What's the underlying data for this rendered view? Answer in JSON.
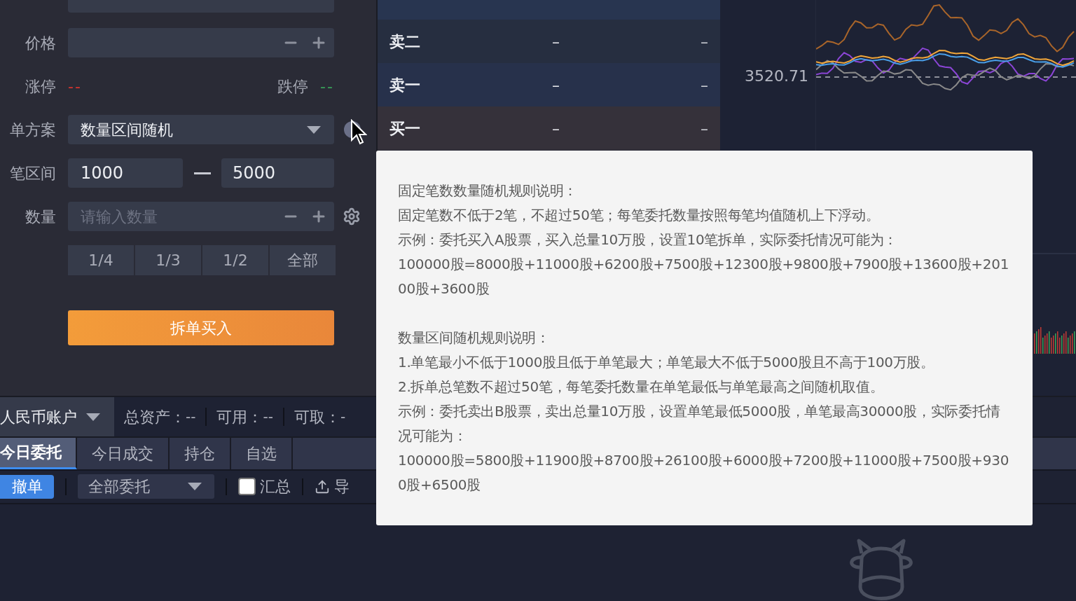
{
  "order_form": {
    "price": {
      "label": "价格"
    },
    "limits": [
      {
        "label": "涨停",
        "value": "--",
        "kind": "up"
      },
      {
        "label": "跌停",
        "value": "--",
        "kind": "down"
      }
    ],
    "split_plan": {
      "label": "单方案",
      "value": "数量区间随机"
    },
    "range": {
      "label": "笔区间",
      "min": "1000",
      "max": "5000"
    },
    "quantity": {
      "label": "数量",
      "placeholder": "请输入数量"
    },
    "fractions": [
      "1/4",
      "1/3",
      "1/2",
      "全部"
    ],
    "submit": "拆单买入"
  },
  "order_book": {
    "rows": [
      {
        "label": "卖二",
        "price": "–",
        "volume": "–",
        "kind": "sell"
      },
      {
        "label": "卖一",
        "price": "–",
        "volume": "–",
        "kind": "sell"
      },
      {
        "label": "买一",
        "price": "–",
        "volume": "–",
        "kind": "buy"
      }
    ]
  },
  "chart": {
    "price_label": "3520.71"
  },
  "account_bar": {
    "account": "人民币账户",
    "stats": [
      {
        "label": "总资产：",
        "value": "--"
      },
      {
        "label": "可用：",
        "value": "--"
      },
      {
        "label": "可取：",
        "value": "-"
      }
    ]
  },
  "tabs": [
    {
      "label": "今日委托",
      "selected": true
    },
    {
      "label": "今日成交",
      "selected": false
    },
    {
      "label": "持仓",
      "selected": false
    },
    {
      "label": "自选",
      "selected": false
    }
  ],
  "toolbar": {
    "cancel": "撤单",
    "filter": "全部委托",
    "summary": {
      "label": "汇总",
      "checked": false
    },
    "export": "导"
  },
  "tooltip": {
    "sections": [
      {
        "title": "固定笔数数量随机规则说明：",
        "lines": [
          "固定笔数不低于2笔，不超过50笔；每笔委托数量按照每笔均值随机上下浮动。",
          "示例：委托买入A股票，买入总量10万股，设置10笔拆单，实际委托情况可能为：",
          "100000股=8000股+11000股+6200股+7500股+12300股+9800股+7900股+13600股+20100股+3600股"
        ]
      },
      {
        "title": "数量区间随机规则说明：",
        "lines": [
          "1.单笔最小不低于1000股且低于单笔最大；单笔最大不低于5000股且不高于100万股。",
          "2.拆单总笔数不超过50笔，每笔委托数量在单笔最低与单笔最高之间随机取值。",
          "示例：委托卖出B股票，卖出总量10万股，设置单笔最低5000股，单笔最高30000股，实际委托情况可能为：",
          "100000股=5800股+11900股+8700股+26100股+6000股+7200股+11000股+7500股+9300股+6500股"
        ]
      }
    ]
  }
}
